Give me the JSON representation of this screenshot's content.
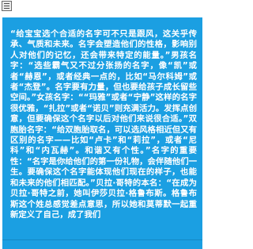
{
  "toolbar": {
    "menu_icon": "menu-icon"
  },
  "article": {
    "background_color": "#1b9fe2",
    "text_color": "#ffffff",
    "text": "“给宝宝选个合适的名字可不只是跟风，这关乎传承、气质和未来。名字会塑造他们的性格，影响别人对他们的记忆，还会带来特定的能量。”男孩名字：“选些霸气又不过分张扬的名字，像“凯”或者“赫恩”，或者经典一点的，比如“马尔科姆”或者“杰登”。名字要有力量，但也要给孩子成长留些空间。”女孩名字：““玛雅”或者“宁静”这样的名字很优雅，“扎拉”或者“诺贝”则充满活力。发挥点创意，但要确保这个名字以后对他们来说很合适。”双胞胎名字：“给双胞胎取名，可以选风格相近但又有区别的名字——比如“卢卡”和“莉拉”，或者“尼科”和“内瓦赫”。和谐又有个性。”名字的重要性：“名字是你给他们的第一份礼物，会伴随他们一生。要确保这个名字能体现他们现在的样子，也能和未来的他们相匹配。”贝拉·哥特的本名：“在成为贝拉·哥特之前，她叫伊莎贝拉·格鲁布斯。格鲁布斯这个姓总感觉差点意思，所以她和莫蒂默一起重新定义了自己，成了我们"
  }
}
